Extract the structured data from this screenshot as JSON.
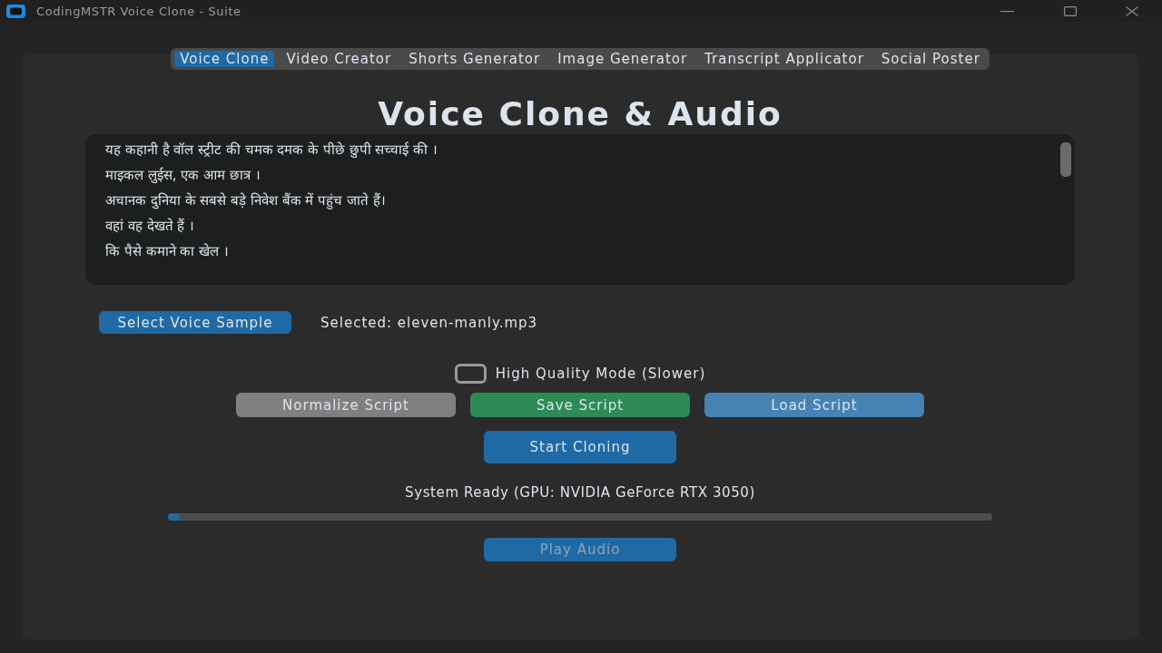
{
  "window": {
    "title": "CodingMSTR Voice Clone - Suite"
  },
  "tabs": [
    {
      "label": "Voice Clone",
      "selected": true
    },
    {
      "label": "Video Creator",
      "selected": false
    },
    {
      "label": "Shorts Generator",
      "selected": false
    },
    {
      "label": "Image Generator",
      "selected": false
    },
    {
      "label": "Transcript Applicator",
      "selected": false
    },
    {
      "label": "Social Poster",
      "selected": false
    }
  ],
  "heading": "Voice Clone & Audio",
  "script_box": {
    "lines": [
      "यह कहानी है वॉल स्ट्रीट की चमक दमक के पीछे छुपी सच्चाई की ।",
      "माइकल लुईस, एक आम छात्र ।",
      "अचानक दुनिया के सबसे बड़े निवेश बैंक में पहुंच जाते हैं।",
      "वहां वह देखते हैं ।",
      "कि पैसे कमाने का खेल ।"
    ]
  },
  "voice_sample": {
    "button": "Select Voice Sample",
    "selected_label": "Selected: eleven-manly.mp3"
  },
  "high_quality": {
    "label": "High Quality Mode (Slower)",
    "checked": false
  },
  "script_buttons": [
    {
      "label": "Normalize Script",
      "color": "#808080"
    },
    {
      "label": "Save Script",
      "color": "#2e8b57"
    },
    {
      "label": "Load Script",
      "color": "#4682b4"
    }
  ],
  "start_button": {
    "label": "Start Cloning"
  },
  "status": "System Ready (GPU: NVIDIA GeForce RTX 3050)",
  "progress": {
    "level": 0.013
  },
  "play_button": {
    "label": "Play Audio",
    "disabled": true
  }
}
